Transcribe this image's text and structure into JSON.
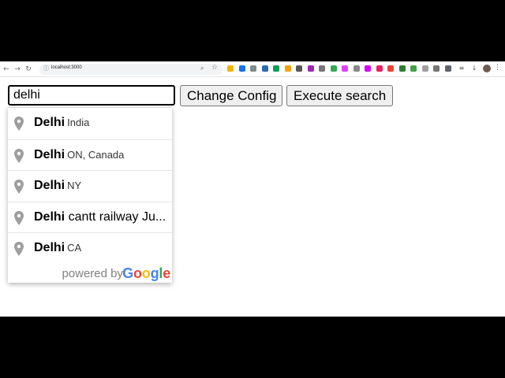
{
  "browser": {
    "url": "localhost:3000",
    "extensions": [
      {
        "name": "extension-1",
        "color": "#f4b400"
      },
      {
        "name": "extension-2",
        "color": "#1a73e8"
      },
      {
        "name": "extension-3",
        "color": "#7f8c8d"
      },
      {
        "name": "extension-4",
        "color": "#2b6cb0"
      },
      {
        "name": "extension-5",
        "color": "#0f9d58"
      },
      {
        "name": "extension-6",
        "color": "#f6a400"
      },
      {
        "name": "extension-7",
        "color": "#555555"
      },
      {
        "name": "extension-8",
        "color": "#9c27b0"
      },
      {
        "name": "extension-9",
        "color": "#777777"
      },
      {
        "name": "extension-10",
        "color": "#34a853"
      },
      {
        "name": "extension-11",
        "color": "#e040fb"
      },
      {
        "name": "extension-12",
        "color": "#888888"
      },
      {
        "name": "extension-13",
        "color": "#d500f9"
      },
      {
        "name": "extension-14",
        "color": "#e91e63"
      },
      {
        "name": "extension-15",
        "color": "#ea4335"
      },
      {
        "name": "extension-16",
        "color": "#2e7d32"
      },
      {
        "name": "extension-17",
        "color": "#43a047"
      },
      {
        "name": "extension-18",
        "color": "#9e9e9e"
      },
      {
        "name": "extension-19",
        "color": "#757575"
      },
      {
        "name": "extension-20",
        "color": "#5f6368"
      }
    ]
  },
  "search": {
    "value": "delhi"
  },
  "buttons": {
    "change_config": "Change Config",
    "execute_search": "Execute search"
  },
  "suggestions": [
    {
      "main": "Delhi",
      "rest": "",
      "secondary": "India"
    },
    {
      "main": "Delhi",
      "rest": "",
      "secondary": "ON, Canada"
    },
    {
      "main": "Delhi",
      "rest": "",
      "secondary": "NY"
    },
    {
      "main": "Delhi",
      "rest": " cantt railway Ju...",
      "secondary": ""
    },
    {
      "main": "Delhi",
      "rest": "",
      "secondary": "CA"
    }
  ],
  "footer": {
    "powered_by": "powered by",
    "google_letters": [
      {
        "ch": "G",
        "color": "#4285F4"
      },
      {
        "ch": "o",
        "color": "#EA4335"
      },
      {
        "ch": "o",
        "color": "#FBBC05"
      },
      {
        "ch": "g",
        "color": "#4285F4"
      },
      {
        "ch": "l",
        "color": "#34A853"
      },
      {
        "ch": "e",
        "color": "#EA4335"
      }
    ]
  },
  "colors": {
    "pin": "#9e9e9e"
  }
}
